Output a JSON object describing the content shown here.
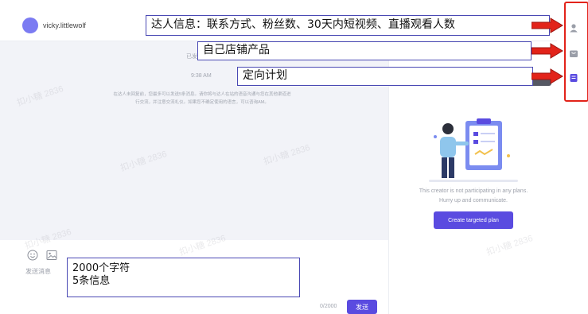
{
  "header": {
    "username": "vicky.littlewolf"
  },
  "chat": {
    "clipped_time": "已发",
    "time": "9:38 AM",
    "notice": "在达人未回复前，您最多可以发送5条消息。请你将与达人在站的语音沟通与您在其他渠道进行交流，并注意交流礼仪。如果您不确定使用的语言，可以咨询AM。"
  },
  "compose": {
    "placeholder": "发送消息",
    "counter": "0/2000",
    "send_label": "发送"
  },
  "plan_panel": {
    "message_line1": "This creator is not participating in any plans.",
    "message_line2": "Hurry up and communicate.",
    "create_button_label": "Create targeted plan"
  },
  "rail": {
    "icons": [
      "creator-profile-icon",
      "shop-products-icon",
      "targeted-plan-icon"
    ],
    "highlight_color": "#e2231a"
  },
  "annotations": {
    "creator_info": "达人信息：联系方式、粉丝数、30天内短视频、直播观看人数",
    "shop_products": "自己店铺产品",
    "targeted_plan": "定向计划",
    "compose_limit_line1": "2000个字符",
    "compose_limit_line2": "5条信息"
  },
  "watermark_text": "扣小糖 2836",
  "colors": {
    "accent": "#5a4be0",
    "avatar": "#7b7bf2",
    "annotation_border": "#4a49b4",
    "arrow": "#e2231a",
    "chat_background": "#f2f3f8"
  }
}
